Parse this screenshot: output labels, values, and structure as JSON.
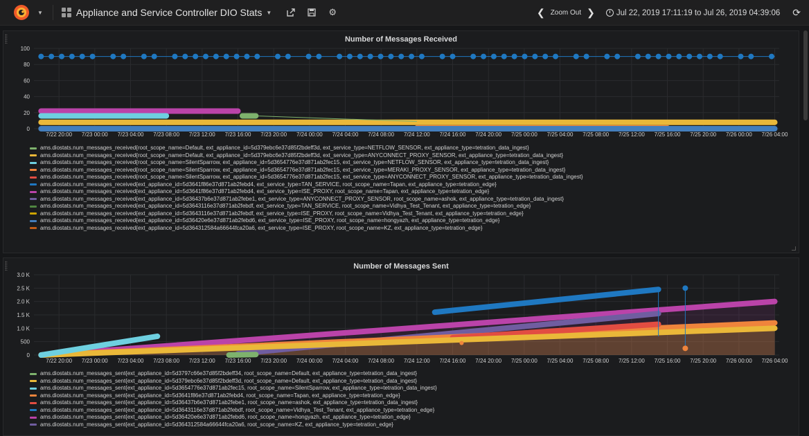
{
  "navbar": {
    "dashboard_title": "Appliance and Service Controller DIO Stats",
    "zoom_out": "Zoom Out",
    "time_range": "Jul 22, 2019 17:11:19 to Jul 26, 2019 04:39:06"
  },
  "icons": [
    "grafana-logo-icon",
    "dashboard-grid-icon",
    "share-icon",
    "save-icon",
    "settings-gear-icon",
    "chevron-left-icon",
    "chevron-right-icon",
    "clock-icon",
    "refresh-icon"
  ],
  "colors": {
    "green": "#7eb26d",
    "yellow": "#eab839",
    "cyan": "#6ed0e0",
    "orange": "#ef843c",
    "red": "#e24d42",
    "blue": "#1f78c1",
    "purple": "#ba43a9",
    "violet": "#705da0",
    "olive": "#508642",
    "dark_yellow": "#cca300",
    "dark_blue": "#447ebc",
    "rust": "#c15c17"
  },
  "panel1": {
    "title": "Number of Messages Received",
    "legend": [
      "ams.diostats.num_messages_received{root_scope_name=Default, ext_appliance_id=5d379ebc6e37d85f2bdeff3d, ext_service_type=NETFLOW_SENSOR, ext_appliance_type=tetration_data_ingest}",
      "ams.diostats.num_messages_received{root_scope_name=Default, ext_appliance_id=5d379ebc6e37d85f2bdeff3d, ext_service_type=ANYCONNECT_PROXY_SENSOR, ext_appliance_type=tetration_data_ingest}",
      "ams.diostats.num_messages_received{root_scope_name=SilentSparrow, ext_appliance_id=5d3654776e37d871ab2fec15, ext_service_type=NETFLOW_SENSOR, ext_appliance_type=tetration_data_ingest}",
      "ams.diostats.num_messages_received{root_scope_name=SilentSparrow, ext_appliance_id=5d3654776e37d871ab2fec15, ext_service_type=MERAKI_PROXY_SENSOR, ext_appliance_type=tetration_data_ingest}",
      "ams.diostats.num_messages_received{root_scope_name=SilentSparrow, ext_appliance_id=5d3654776e37d871ab2fec15, ext_service_type=ANYCONNECT_PROXY_SENSOR, ext_appliance_type=tetration_data_ingest}",
      "ams.diostats.num_messages_received{ext_appliance_id=5d3641f86e37d871ab2febd4, ext_service_type=TAN_SERVICE, root_scope_name=Tapan, ext_appliance_type=tetration_edge}",
      "ams.diostats.num_messages_received{ext_appliance_id=5d3641f86e37d871ab2febd4, ext_service_type=ISE_PROXY, root_scope_name=Tapan, ext_appliance_type=tetration_edge}",
      "ams.diostats.num_messages_received{ext_appliance_id=5d36437b6e37d871ab2febe1, ext_service_type=ANYCONNECT_PROXY_SENSOR, root_scope_name=ashok, ext_appliance_type=tetration_data_ingest}",
      "ams.diostats.num_messages_received{ext_appliance_id=5d3643116e37d871ab2febdf, ext_service_type=TAN_SERVICE, root_scope_name=Vidhya_Test_Tenant, ext_appliance_type=tetration_edge}",
      "ams.diostats.num_messages_received{ext_appliance_id=5d3643116e37d871ab2febdf, ext_service_type=ISE_PROXY, root_scope_name=Vidhya_Test_Tenant, ext_appliance_type=tetration_edge}",
      "ams.diostats.num_messages_received{ext_appliance_id=5d36420e6e37d871ab2febd6, ext_service_type=ISE_PROXY, root_scope_name=hongyazh, ext_appliance_type=tetration_edge}",
      "ams.diostats.num_messages_received{ext_appliance_id=5d364312584a66644fca20a6, ext_service_type=ISE_PROXY, root_scope_name=KZ, ext_appliance_type=tetration_edge}"
    ],
    "legend_colors": [
      "#7eb26d",
      "#eab839",
      "#6ed0e0",
      "#ef843c",
      "#e24d42",
      "#1f78c1",
      "#ba43a9",
      "#705da0",
      "#508642",
      "#cca300",
      "#447ebc",
      "#c15c17"
    ]
  },
  "panel2": {
    "title": "Number of Messages Sent",
    "legend": [
      "ams.diostats.num_messages_sent{ext_appliance_id=5d3797c66e37d85f2bdeff34, root_scope_name=Default, ext_appliance_type=tetration_data_ingest}",
      "ams.diostats.num_messages_sent{ext_appliance_id=5d379ebc6e37d85f2bdeff3d, root_scope_name=Default, ext_appliance_type=tetration_data_ingest}",
      "ams.diostats.num_messages_sent{ext_appliance_id=5d3654776e37d871ab2fec15, root_scope_name=SilentSparrow, ext_appliance_type=tetration_data_ingest}",
      "ams.diostats.num_messages_sent{ext_appliance_id=5d3641f86e37d871ab2febd4, root_scope_name=Tapan, ext_appliance_type=tetration_edge}",
      "ams.diostats.num_messages_sent{ext_appliance_id=5d36437b6e37d871ab2febe1, root_scope_name=ashok, ext_appliance_type=tetration_data_ingest}",
      "ams.diostats.num_messages_sent{ext_appliance_id=5d3643116e37d871ab2febdf, root_scope_name=Vidhya_Test_Tenant, ext_appliance_type=tetration_edge}",
      "ams.diostats.num_messages_sent{ext_appliance_id=5d36420e6e37d871ab2febd6, root_scope_name=hongyazh, ext_appliance_type=tetration_edge}",
      "ams.diostats.num_messages_sent{ext_appliance_id=5d364312584a66644fca20a6, root_scope_name=KZ, ext_appliance_type=tetration_edge}"
    ],
    "legend_colors": [
      "#7eb26d",
      "#eab839",
      "#6ed0e0",
      "#ef843c",
      "#e24d42",
      "#1f78c1",
      "#ba43a9",
      "#705da0"
    ]
  },
  "chart_data": [
    {
      "type": "scatter",
      "title": "Number of Messages Received",
      "x_ticks": [
        "7/22 20:00",
        "7/23 00:00",
        "7/23 04:00",
        "7/23 08:00",
        "7/23 12:00",
        "7/23 16:00",
        "7/23 20:00",
        "7/24 00:00",
        "7/24 04:00",
        "7/24 08:00",
        "7/24 12:00",
        "7/24 16:00",
        "7/24 20:00",
        "7/25 00:00",
        "7/25 04:00",
        "7/25 08:00",
        "7/25 12:00",
        "7/25 16:00",
        "7/25 20:00",
        "7/26 00:00",
        "7/26 04:00"
      ],
      "y_ticks": [
        "0",
        "20",
        "40",
        "60",
        "80",
        "100"
      ],
      "ylim": [
        0,
        100
      ],
      "xlim_hours": [
        -2.8,
        80.5
      ],
      "series": [
        {
          "color": "#1f78c1",
          "x": [
            -2,
            80
          ],
          "y": [
            90,
            90
          ],
          "style": "dots"
        },
        {
          "color": "#ba43a9",
          "x": [
            -2,
            20
          ],
          "y": [
            22,
            22
          ],
          "style": "thick"
        },
        {
          "color": "#6ed0e0",
          "x": [
            -2,
            12
          ],
          "y": [
            16,
            16
          ],
          "style": "thick"
        },
        {
          "color": "#7eb26d",
          "x": [
            20.5,
            22
          ],
          "y": [
            16,
            16
          ],
          "style": "thick"
        },
        {
          "color": "#eab839",
          "x": [
            -2,
            80
          ],
          "y": [
            8,
            8
          ],
          "style": "thick"
        },
        {
          "color": "#ef843c",
          "x": [
            40,
            68
          ],
          "y": [
            1,
            1
          ],
          "style": "thick"
        },
        {
          "color": "#447ebc",
          "x": [
            -2,
            80
          ],
          "y": [
            0,
            0
          ],
          "style": "thick"
        }
      ]
    },
    {
      "type": "line",
      "title": "Number of Messages Sent",
      "x_ticks": [
        "7/22 20:00",
        "7/23 00:00",
        "7/23 04:00",
        "7/23 08:00",
        "7/23 12:00",
        "7/23 16:00",
        "7/23 20:00",
        "7/24 00:00",
        "7/24 04:00",
        "7/24 08:00",
        "7/24 12:00",
        "7/24 16:00",
        "7/24 20:00",
        "7/25 00:00",
        "7/25 04:00",
        "7/25 08:00",
        "7/25 12:00",
        "7/25 16:00",
        "7/25 20:00",
        "7/26 00:00",
        "7/26 04:00"
      ],
      "y_ticks": [
        "0",
        "500",
        "1.0 K",
        "1.5 K",
        "2.0 K",
        "2.5 K",
        "3.0 K"
      ],
      "ylim": [
        0,
        3000
      ],
      "series": [
        {
          "color": "#1f78c1",
          "x": [
            42,
            67
          ],
          "y": [
            1600,
            2450
          ]
        },
        {
          "color": "#ba43a9",
          "x": [
            -2,
            80
          ],
          "y": [
            0,
            2000
          ]
        },
        {
          "color": "#705da0",
          "x": [
            20,
            67
          ],
          "y": [
            50,
            1550
          ]
        },
        {
          "color": "#ef843c",
          "x": [
            -2,
            80
          ],
          "y": [
            0,
            1200
          ]
        },
        {
          "color": "#e24d42",
          "x": [
            44,
            67
          ],
          "y": [
            650,
            1150
          ]
        },
        {
          "color": "#eab839",
          "x": [
            -2,
            80
          ],
          "y": [
            0,
            1000
          ]
        },
        {
          "color": "#6ed0e0",
          "x": [
            -2,
            11
          ],
          "y": [
            0,
            700
          ]
        },
        {
          "color": "#7eb26d",
          "x": [
            19,
            22
          ],
          "y": [
            0,
            20
          ]
        }
      ]
    }
  ]
}
